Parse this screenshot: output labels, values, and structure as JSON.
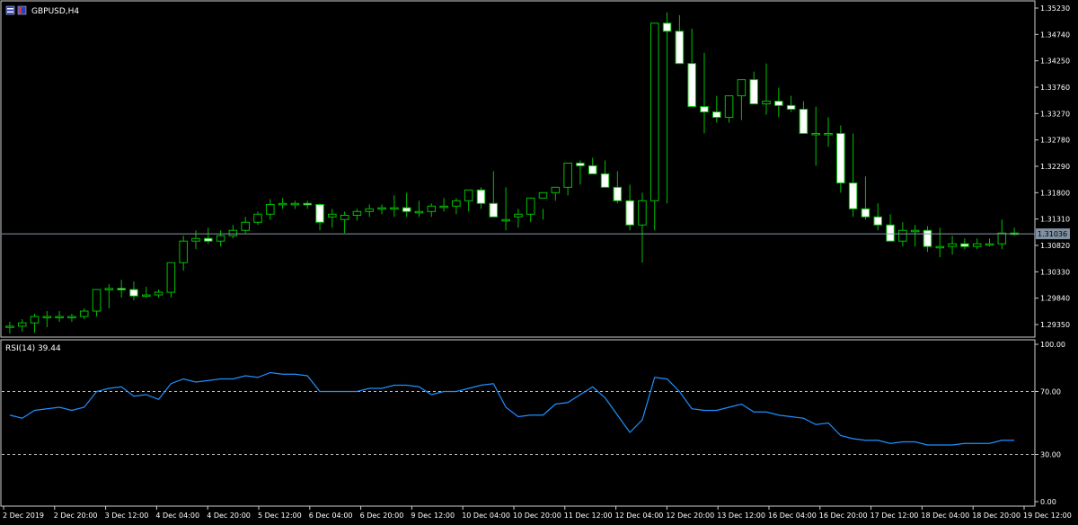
{
  "window": {
    "symbol_label": "GBPUSD,H4"
  },
  "colors": {
    "background": "#000000",
    "frame": "#cfcfcf",
    "bull_body": "#000000",
    "bear_body": "#ffffff",
    "wick": "#00c000",
    "grid_level": "#c0c0c0",
    "rsi_line": "#1e90ff",
    "bid_line": "#8899aa"
  },
  "price_axis": {
    "labels": [
      "1.35230",
      "1.34740",
      "1.34250",
      "1.33760",
      "1.33270",
      "1.32780",
      "1.32290",
      "1.31800",
      "1.31310",
      "1.30820",
      "1.30330",
      "1.29840",
      "1.29350"
    ],
    "current_price": "1.31036"
  },
  "rsi_panel": {
    "title": "RSI(14) 39.44",
    "levels_labels": [
      "100.00",
      "70.00",
      "30.00",
      "0.00"
    ]
  },
  "time_axis": {
    "labels": [
      "2 Dec 2019",
      "2 Dec 20:00",
      "3 Dec 12:00",
      "4 Dec 04:00",
      "4 Dec 20:00",
      "5 Dec 12:00",
      "6 Dec 04:00",
      "6 Dec 20:00",
      "9 Dec 12:00",
      "10 Dec 04:00",
      "10 Dec 20:00",
      "11 Dec 12:00",
      "12 Dec 04:00",
      "12 Dec 20:00",
      "13 Dec 12:00",
      "16 Dec 04:00",
      "16 Dec 20:00",
      "17 Dec 12:00",
      "18 Dec 04:00",
      "18 Dec 20:00",
      "19 Dec 12:00"
    ]
  },
  "chart_data": [
    {
      "type": "candlestick",
      "title": "GBPUSD,H4",
      "ylim": [
        1.2915,
        1.353
      ],
      "open": [
        1.293,
        1.2932,
        1.2938,
        1.295,
        1.295,
        1.295,
        1.295,
        1.296,
        1.3,
        1.3002,
        1.3,
        1.2988,
        1.299,
        1.2995,
        1.305,
        1.309,
        1.3095,
        1.309,
        1.31,
        1.311,
        1.3125,
        1.314,
        1.3158,
        1.316,
        1.316,
        1.3158,
        1.3135,
        1.313,
        1.3138,
        1.3145,
        1.315,
        1.3152,
        1.3152,
        1.3145,
        1.3145,
        1.3155,
        1.3155,
        1.3165,
        1.3185,
        1.316,
        1.313,
        1.3135,
        1.314,
        1.317,
        1.318,
        1.319,
        1.3235,
        1.323,
        1.3215,
        1.319,
        1.3165,
        1.312,
        1.3165,
        1.3495,
        1.348,
        1.342,
        1.334,
        1.333,
        1.332,
        1.336,
        1.339,
        1.3345,
        1.335,
        1.3342,
        1.3335,
        1.329,
        1.329,
        1.329,
        1.3198,
        1.315,
        1.3135,
        1.312,
        1.309,
        1.311,
        1.311,
        1.308,
        1.308,
        1.3085,
        1.308,
        1.3085,
        1.3085,
        1.3105
      ],
      "high": [
        1.294,
        1.2945,
        1.2955,
        1.296,
        1.296,
        1.2955,
        1.2965,
        1.3,
        1.301,
        1.3018,
        1.3015,
        1.3005,
        1.3,
        1.305,
        1.31,
        1.311,
        1.3115,
        1.311,
        1.312,
        1.3135,
        1.3145,
        1.3168,
        1.317,
        1.3165,
        1.3165,
        1.316,
        1.315,
        1.3145,
        1.315,
        1.3158,
        1.3158,
        1.3175,
        1.318,
        1.3165,
        1.316,
        1.317,
        1.317,
        1.3185,
        1.319,
        1.322,
        1.319,
        1.315,
        1.314,
        1.315,
        1.318,
        1.321,
        1.324,
        1.3245,
        1.324,
        1.322,
        1.3195,
        1.318,
        1.319,
        1.3515,
        1.351,
        1.3485,
        1.344,
        1.336,
        1.335,
        1.3375,
        1.3405,
        1.342,
        1.3375,
        1.336,
        1.335,
        1.334,
        1.332,
        1.3305,
        1.329,
        1.321,
        1.316,
        1.314,
        1.3125,
        1.312,
        1.3118,
        1.3115,
        1.31,
        1.3095,
        1.3095,
        1.3095,
        1.313,
        1.3115
      ],
      "low": [
        1.2918,
        1.2922,
        1.292,
        1.293,
        1.294,
        1.294,
        1.2945,
        1.295,
        1.2965,
        1.2985,
        1.298,
        1.2985,
        1.2985,
        1.2985,
        1.3035,
        1.3075,
        1.3085,
        1.308,
        1.3095,
        1.3105,
        1.312,
        1.313,
        1.315,
        1.315,
        1.315,
        1.311,
        1.3115,
        1.3105,
        1.3128,
        1.3135,
        1.314,
        1.3135,
        1.3135,
        1.3135,
        1.3135,
        1.3145,
        1.314,
        1.3145,
        1.315,
        1.3155,
        1.311,
        1.3115,
        1.3125,
        1.313,
        1.3165,
        1.3175,
        1.3195,
        1.3215,
        1.319,
        1.316,
        1.311,
        1.305,
        1.311,
        1.316,
        1.346,
        1.341,
        1.329,
        1.331,
        1.331,
        1.3315,
        1.335,
        1.3325,
        1.332,
        1.333,
        1.332,
        1.323,
        1.3265,
        1.318,
        1.3135,
        1.313,
        1.311,
        1.309,
        1.308,
        1.308,
        1.307,
        1.306,
        1.3065,
        1.3075,
        1.3075,
        1.308,
        1.3075,
        1.31
      ],
      "close": [
        1.2932,
        1.2938,
        1.295,
        1.295,
        1.295,
        1.295,
        1.296,
        1.3,
        1.3002,
        1.3,
        1.2988,
        1.299,
        1.2995,
        1.305,
        1.309,
        1.3095,
        1.309,
        1.31,
        1.311,
        1.3125,
        1.314,
        1.3158,
        1.316,
        1.316,
        1.3158,
        1.3125,
        1.314,
        1.3138,
        1.3145,
        1.315,
        1.3152,
        1.3152,
        1.3145,
        1.3145,
        1.3155,
        1.3155,
        1.3165,
        1.3185,
        1.316,
        1.3135,
        1.313,
        1.314,
        1.317,
        1.318,
        1.319,
        1.3235,
        1.323,
        1.3215,
        1.319,
        1.3165,
        1.312,
        1.3165,
        1.3495,
        1.348,
        1.342,
        1.334,
        1.333,
        1.332,
        1.336,
        1.339,
        1.3345,
        1.335,
        1.3342,
        1.3335,
        1.329,
        1.329,
        1.329,
        1.3198,
        1.315,
        1.3135,
        1.312,
        1.309,
        1.311,
        1.311,
        1.308,
        1.308,
        1.3085,
        1.308,
        1.3085,
        1.3085,
        1.3105,
        1.3104
      ]
    },
    {
      "type": "line",
      "title": "RSI(14) 39.44",
      "ylim": [
        0,
        100
      ],
      "values": [
        55,
        53,
        58,
        59,
        60,
        58,
        60,
        70,
        72,
        73,
        67,
        68,
        65,
        75,
        78,
        76,
        77,
        78,
        78,
        80,
        79,
        82,
        81,
        81,
        80,
        70,
        70,
        70,
        70,
        72,
        72,
        74,
        74,
        73,
        68,
        70,
        70,
        72,
        74,
        75,
        60,
        54,
        55,
        55,
        62,
        63,
        68,
        73,
        66,
        55,
        44,
        52,
        79,
        78,
        70,
        59,
        58,
        58,
        60,
        62,
        57,
        57,
        55,
        54,
        53,
        49,
        50,
        42,
        40,
        39,
        39,
        37,
        38,
        38,
        36,
        36,
        36,
        37,
        37,
        37,
        39,
        39
      ]
    }
  ]
}
